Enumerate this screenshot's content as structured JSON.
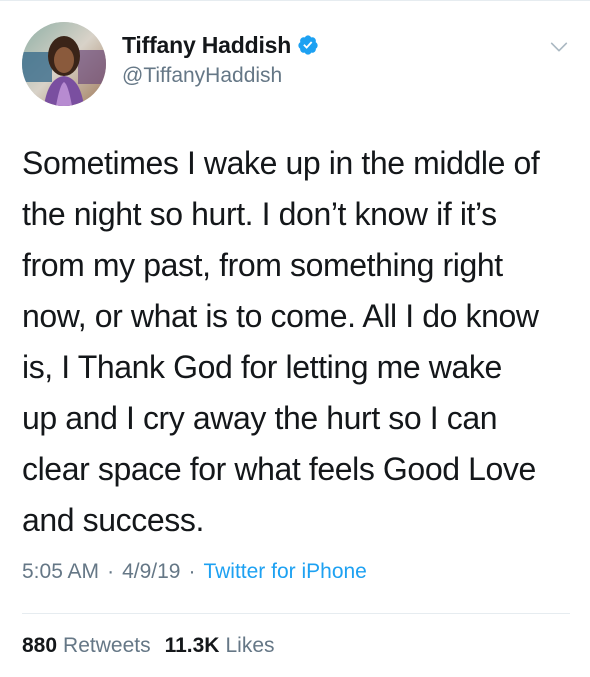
{
  "user": {
    "display_name": "Tiffany Haddish",
    "handle": "@TiffanyHaddish",
    "verified": true,
    "avatar_icon": "profile-photo"
  },
  "tweet": {
    "text": "Sometimes I wake up in the middle of\nthe night so hurt. I don’t know if it’s\nfrom my past, from something right\nnow, or what is to come. All I do know\nis, I Thank God for letting me wake\nup and I cry away the hurt so I can\nclear space for what feels Good Love\nand success."
  },
  "meta": {
    "time": "5:05 AM",
    "separator": "·",
    "date": "4/9/19",
    "source": "Twitter for iPhone"
  },
  "stats": {
    "retweets_count": "880",
    "retweets_label": "Retweets",
    "likes_count": "11.3K",
    "likes_label": "Likes"
  },
  "colors": {
    "text": "#14171a",
    "secondary": "#657786",
    "link": "#1da1f2",
    "verified": "#1da1f2",
    "divider": "#e6ecf0"
  }
}
